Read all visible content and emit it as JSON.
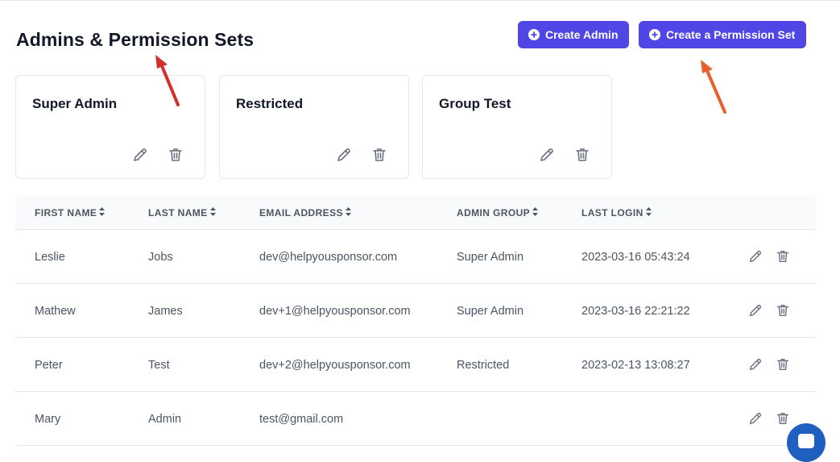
{
  "header": {
    "title": "Admins & Permission Sets",
    "create_admin_label": "Create Admin",
    "create_permission_set_label": "Create a Permission Set"
  },
  "permission_sets": [
    {
      "name": "Super Admin"
    },
    {
      "name": "Restricted"
    },
    {
      "name": "Group Test"
    }
  ],
  "table": {
    "columns": [
      "FIRST NAME",
      "LAST NAME",
      "EMAIL ADDRESS",
      "ADMIN GROUP",
      "LAST LOGIN"
    ],
    "rows": [
      {
        "first_name": "Leslie",
        "last_name": "Jobs",
        "email": "dev@helpyousponsor.com",
        "admin_group": "Super Admin",
        "last_login": "2023-03-16 05:43:24"
      },
      {
        "first_name": "Mathew",
        "last_name": "James",
        "email": "dev+1@helpyousponsor.com",
        "admin_group": "Super Admin",
        "last_login": "2023-03-16 22:21:22"
      },
      {
        "first_name": "Peter",
        "last_name": "Test",
        "email": "dev+2@helpyousponsor.com",
        "admin_group": "Restricted",
        "last_login": "2023-02-13 13:08:27"
      },
      {
        "first_name": "Mary",
        "last_name": "Admin",
        "email": "test@gmail.com",
        "admin_group": "",
        "last_login": ""
      }
    ]
  },
  "colors": {
    "primary": "#4f46e5",
    "annotation_red": "#d0312d",
    "annotation_orange": "#e8612c",
    "chat": "#1e5fbf"
  },
  "icons": [
    "plus-circle-icon",
    "pencil-icon",
    "trash-icon",
    "sort-icon",
    "chat-icon"
  ]
}
